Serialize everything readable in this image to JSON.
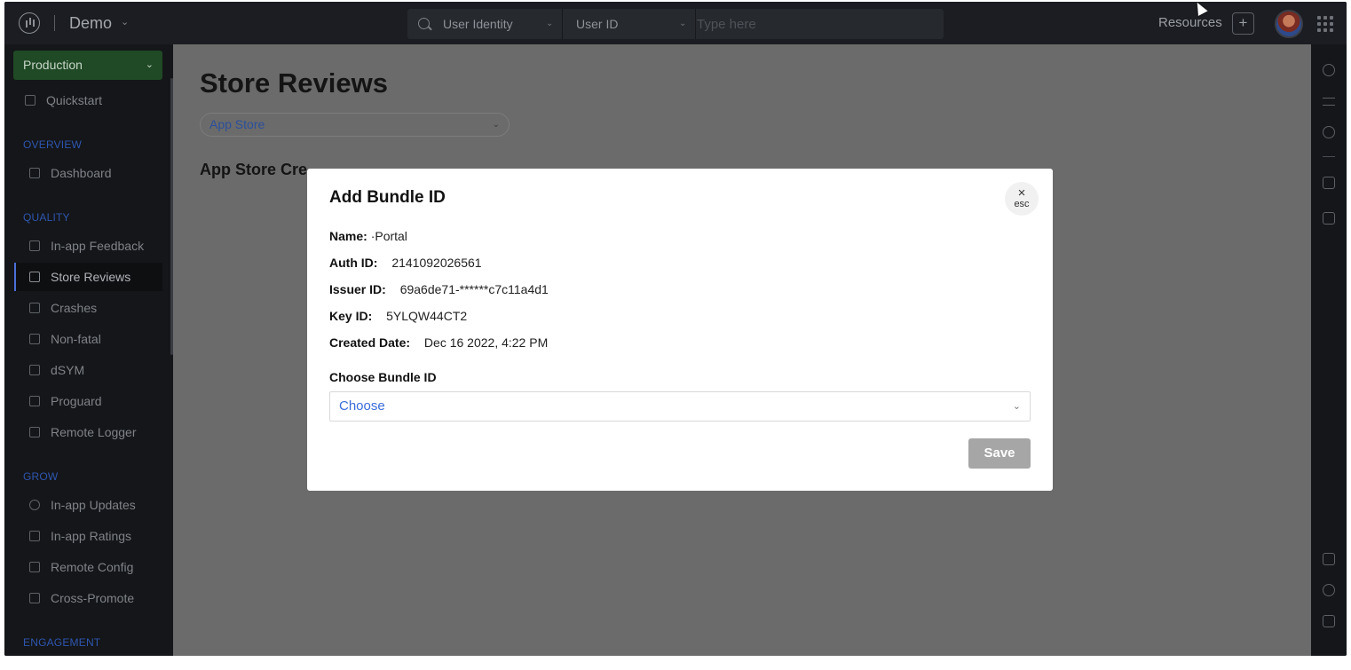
{
  "header": {
    "project_name": "Demo",
    "search": {
      "field1": "User Identity",
      "field2": "User ID",
      "placeholder": "Type here"
    },
    "resources_label": "Resources",
    "add_label": "+"
  },
  "sidebar": {
    "environment": "Production",
    "quickstart": "Quickstart",
    "sections": {
      "overview": "OVERVIEW",
      "quality": "QUALITY",
      "grow": "GROW",
      "engagement": "ENGAGEMENT"
    },
    "items": {
      "dashboard": "Dashboard",
      "in_app_feedback": "In-app Feedback",
      "store_reviews": "Store Reviews",
      "crashes": "Crashes",
      "non_fatal": "Non-fatal",
      "dsym": "dSYM",
      "proguard": "Proguard",
      "remote_logger": "Remote Logger",
      "in_app_updates": "In-app Updates",
      "in_app_ratings": "In-app Ratings",
      "remote_config": "Remote Config",
      "cross_promote": "Cross-Promote"
    },
    "active_item": "Store Reviews"
  },
  "main": {
    "title": "Store Reviews",
    "store_select": "App Store",
    "section_heading": "App Store Cre"
  },
  "modal": {
    "title": "Add Bundle ID",
    "close_label": "esc",
    "fields": {
      "name_label": "Name:",
      "name_value": "·Portal",
      "auth_label": "Auth ID:",
      "auth_value": "2141092026561",
      "issuer_label": "Issuer ID:",
      "issuer_value": "69a6de71-******c7c11a4d1",
      "key_label": "Key ID:",
      "key_value": "5YLQW44CT2",
      "created_label": "Created Date:",
      "created_value": "Dec 16 2022, 4:22 PM"
    },
    "choose_label": "Choose Bundle ID",
    "choose_placeholder": "Choose",
    "save_label": "Save"
  },
  "colors": {
    "accent": "#2f56b0",
    "environment_bg": "#1f4a25",
    "save_disabled": "#a6a6a6",
    "link_blue": "#3b6cd8"
  }
}
